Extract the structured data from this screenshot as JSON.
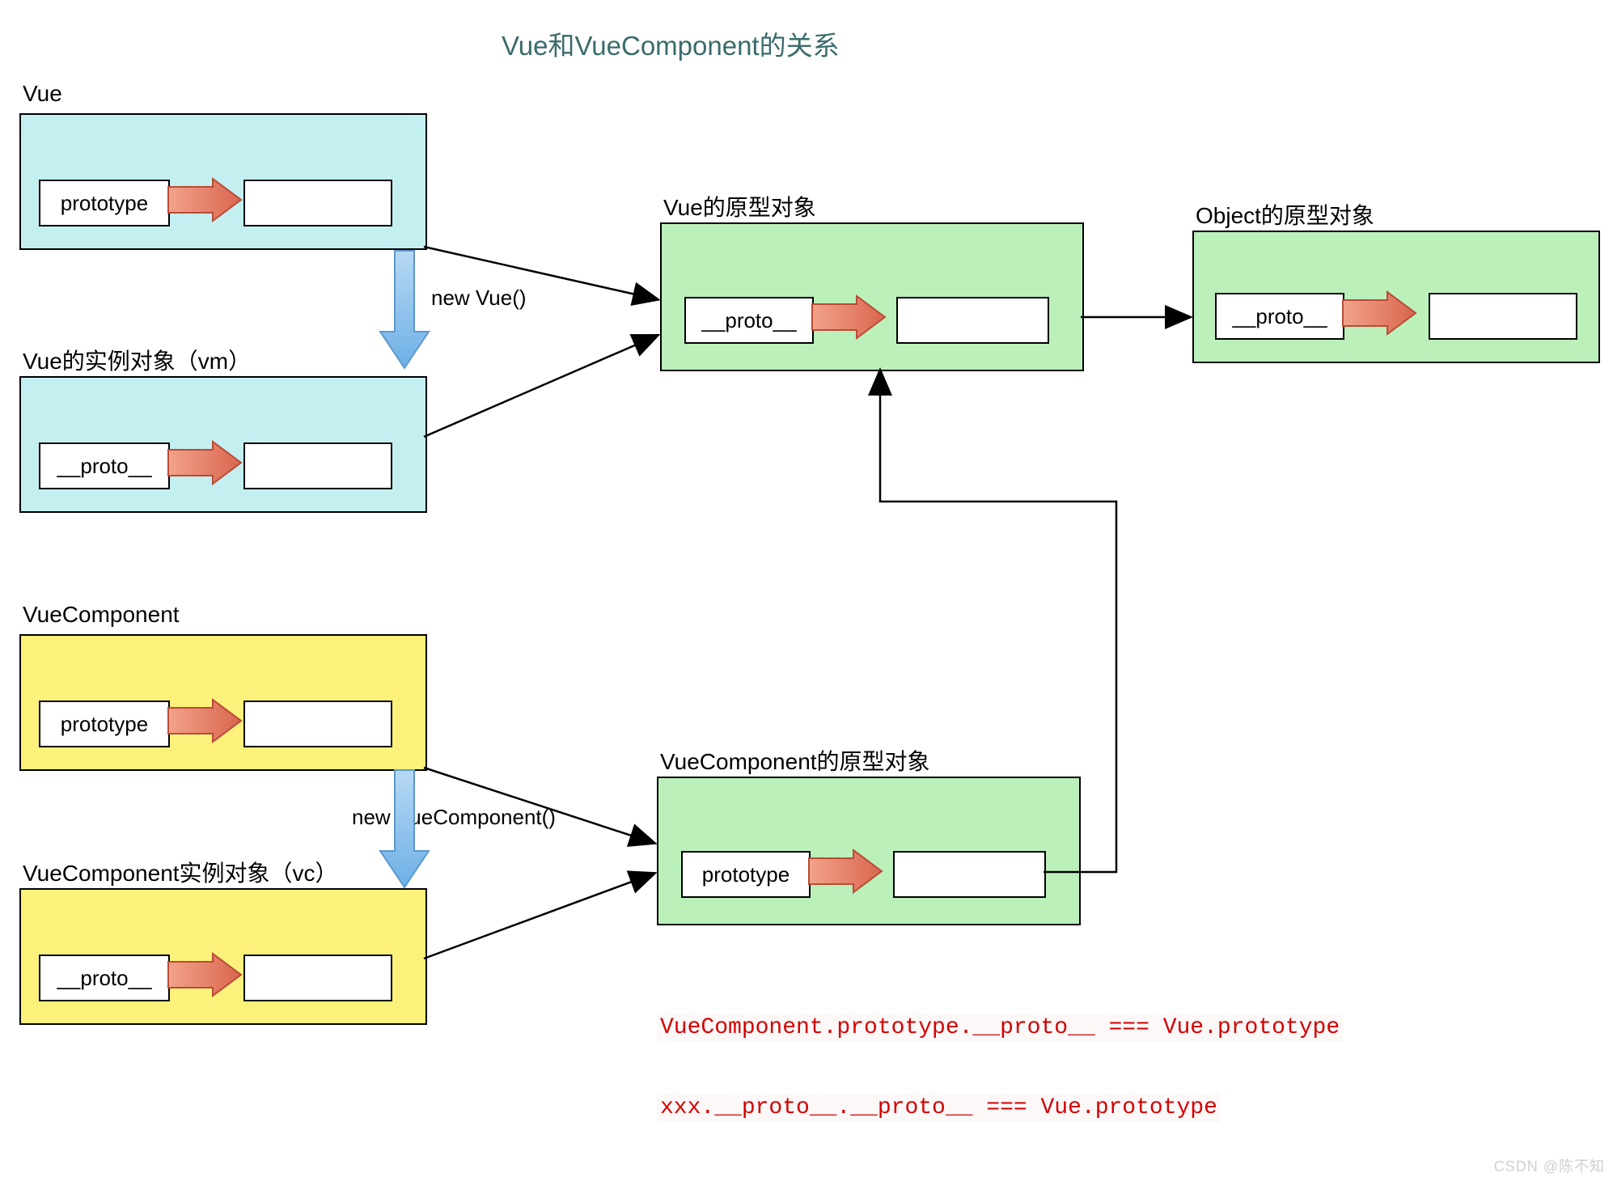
{
  "title": "Vue和VueComponent的关系",
  "boxes": {
    "vue": {
      "label": "Vue",
      "field": "prototype"
    },
    "vue_instance": {
      "label": "Vue的实例对象（vm）",
      "field": "__proto__"
    },
    "vue_prototype": {
      "label": "Vue的原型对象",
      "field": "__proto__"
    },
    "object_prototype": {
      "label": "Object的原型对象",
      "field": "__proto__"
    },
    "vue_component": {
      "label": "VueComponent",
      "field": "prototype"
    },
    "vc_instance": {
      "label": "VueComponent实例对象（vc）",
      "field": "__proto__"
    },
    "vc_prototype": {
      "label": "VueComponent的原型对象",
      "field": "prototype"
    }
  },
  "arrows": {
    "new_vue": "new Vue()",
    "new_vc": "new VueComponent()"
  },
  "code": {
    "line1": "VueComponent.prototype.__proto__ === Vue.prototype",
    "line2": "xxx.__proto__.__proto__ === Vue.prototype"
  },
  "watermark": "CSDN @陈不知"
}
